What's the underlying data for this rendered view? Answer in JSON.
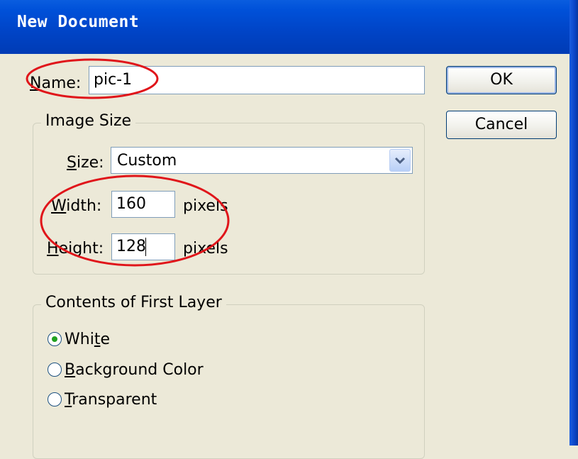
{
  "dialog": {
    "title": "New Document"
  },
  "name": {
    "label_underlined": "N",
    "label_rest": "ame:",
    "value": "pic-1"
  },
  "buttons": {
    "ok": "OK",
    "cancel": "Cancel"
  },
  "image_size": {
    "legend": "Image Size",
    "size_label_underlined": "S",
    "size_label_rest": "ize:",
    "size_value": "Custom",
    "width_label_underlined": "W",
    "width_label_rest": "idth:",
    "width_value": "160",
    "width_unit": "pixels",
    "height_label_underlined": "H",
    "height_label_rest": "eight:",
    "height_value": "128",
    "height_unit": "pixels"
  },
  "contents": {
    "legend": "Contents of First Layer",
    "options": [
      {
        "label_pre": "Whi",
        "label_underlined": "t",
        "label_post": "e",
        "selected": true
      },
      {
        "label_pre": "",
        "label_underlined": "B",
        "label_post": "ackground Color",
        "selected": false
      },
      {
        "label_pre": "",
        "label_underlined": "T",
        "label_post": "ransparent",
        "selected": false
      }
    ]
  },
  "colors": {
    "title_bar": "#0051d9",
    "dialog_bg": "#ece9d8",
    "annotation": "#e0151a",
    "radio_dot": "#21a121"
  }
}
